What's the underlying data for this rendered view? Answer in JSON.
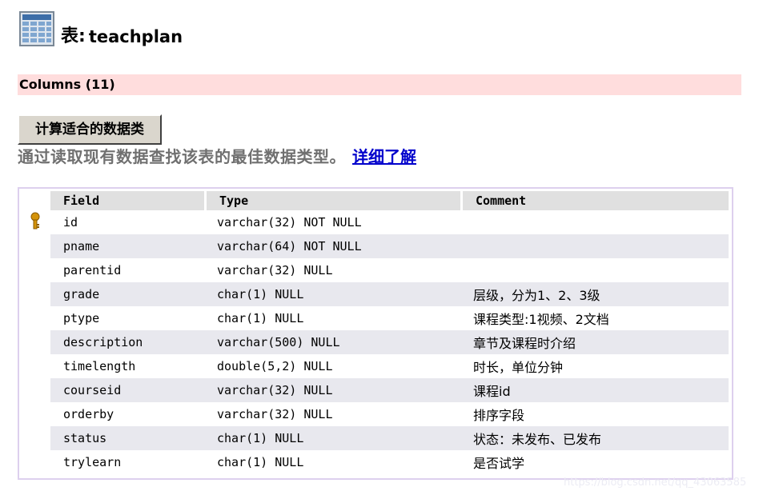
{
  "header": {
    "icon": "table-icon",
    "prefix": "表:",
    "table_name": "teachplan"
  },
  "section": {
    "label": "Columns (11)"
  },
  "actions": {
    "calc_button_label": "计算适合的数据类",
    "description": "通过读取现有数据查找该表的最佳数据类型。",
    "more_link": "详细了解"
  },
  "columns_table": {
    "headers": [
      "Field",
      "Type",
      "Comment"
    ],
    "rows": [
      {
        "field": "id",
        "type": "varchar(32) NOT NULL",
        "comment": "",
        "key": true
      },
      {
        "field": "pname",
        "type": "varchar(64) NOT NULL",
        "comment": "",
        "key": false
      },
      {
        "field": "parentid",
        "type": "varchar(32) NULL",
        "comment": "",
        "key": false
      },
      {
        "field": "grade",
        "type": "char(1) NULL",
        "comment": "层级，分为1、2、3级",
        "key": false
      },
      {
        "field": "ptype",
        "type": "char(1) NULL",
        "comment": "课程类型:1视频、2文档",
        "key": false
      },
      {
        "field": "description",
        "type": "varchar(500) NULL",
        "comment": "章节及课程时介绍",
        "key": false
      },
      {
        "field": "timelength",
        "type": "double(5,2) NULL",
        "comment": "时长，单位分钟",
        "key": false
      },
      {
        "field": "courseid",
        "type": "varchar(32) NULL",
        "comment": "课程id",
        "key": false
      },
      {
        "field": "orderby",
        "type": "varchar(32) NULL",
        "comment": "排序字段",
        "key": false
      },
      {
        "field": "status",
        "type": "char(1) NULL",
        "comment": "状态：未发布、已发布",
        "key": false
      },
      {
        "field": "trylearn",
        "type": "char(1) NULL",
        "comment": "是否试学",
        "key": false
      }
    ]
  },
  "watermark": "https://blog.csdn.net/qq_43063585",
  "colors": {
    "section_bg": "#ffdddd",
    "link": "#0000cc",
    "key_icon": "#d4930a"
  }
}
